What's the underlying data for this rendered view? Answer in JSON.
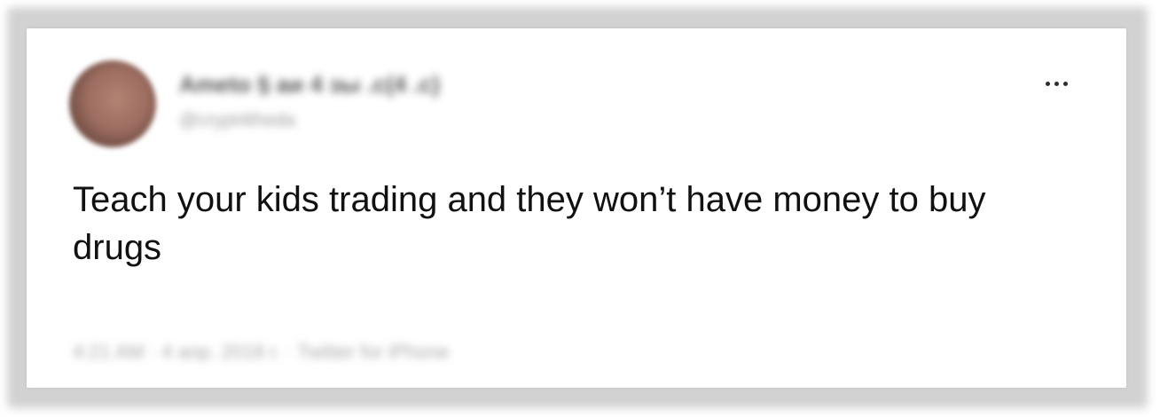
{
  "tweet": {
    "author": {
      "display_name": "Ameto § aи 4 зы .с(4 .с)",
      "handle": "@crypt4theda",
      "avatar_icon": "avatar-image"
    },
    "text": "Teach your kids trading and they won’t have money to buy drugs",
    "meta": "4:21 AM · 4 апр. 2018 г. · Twitter for iPhone",
    "more_icon": "more-horizontal-icon"
  }
}
